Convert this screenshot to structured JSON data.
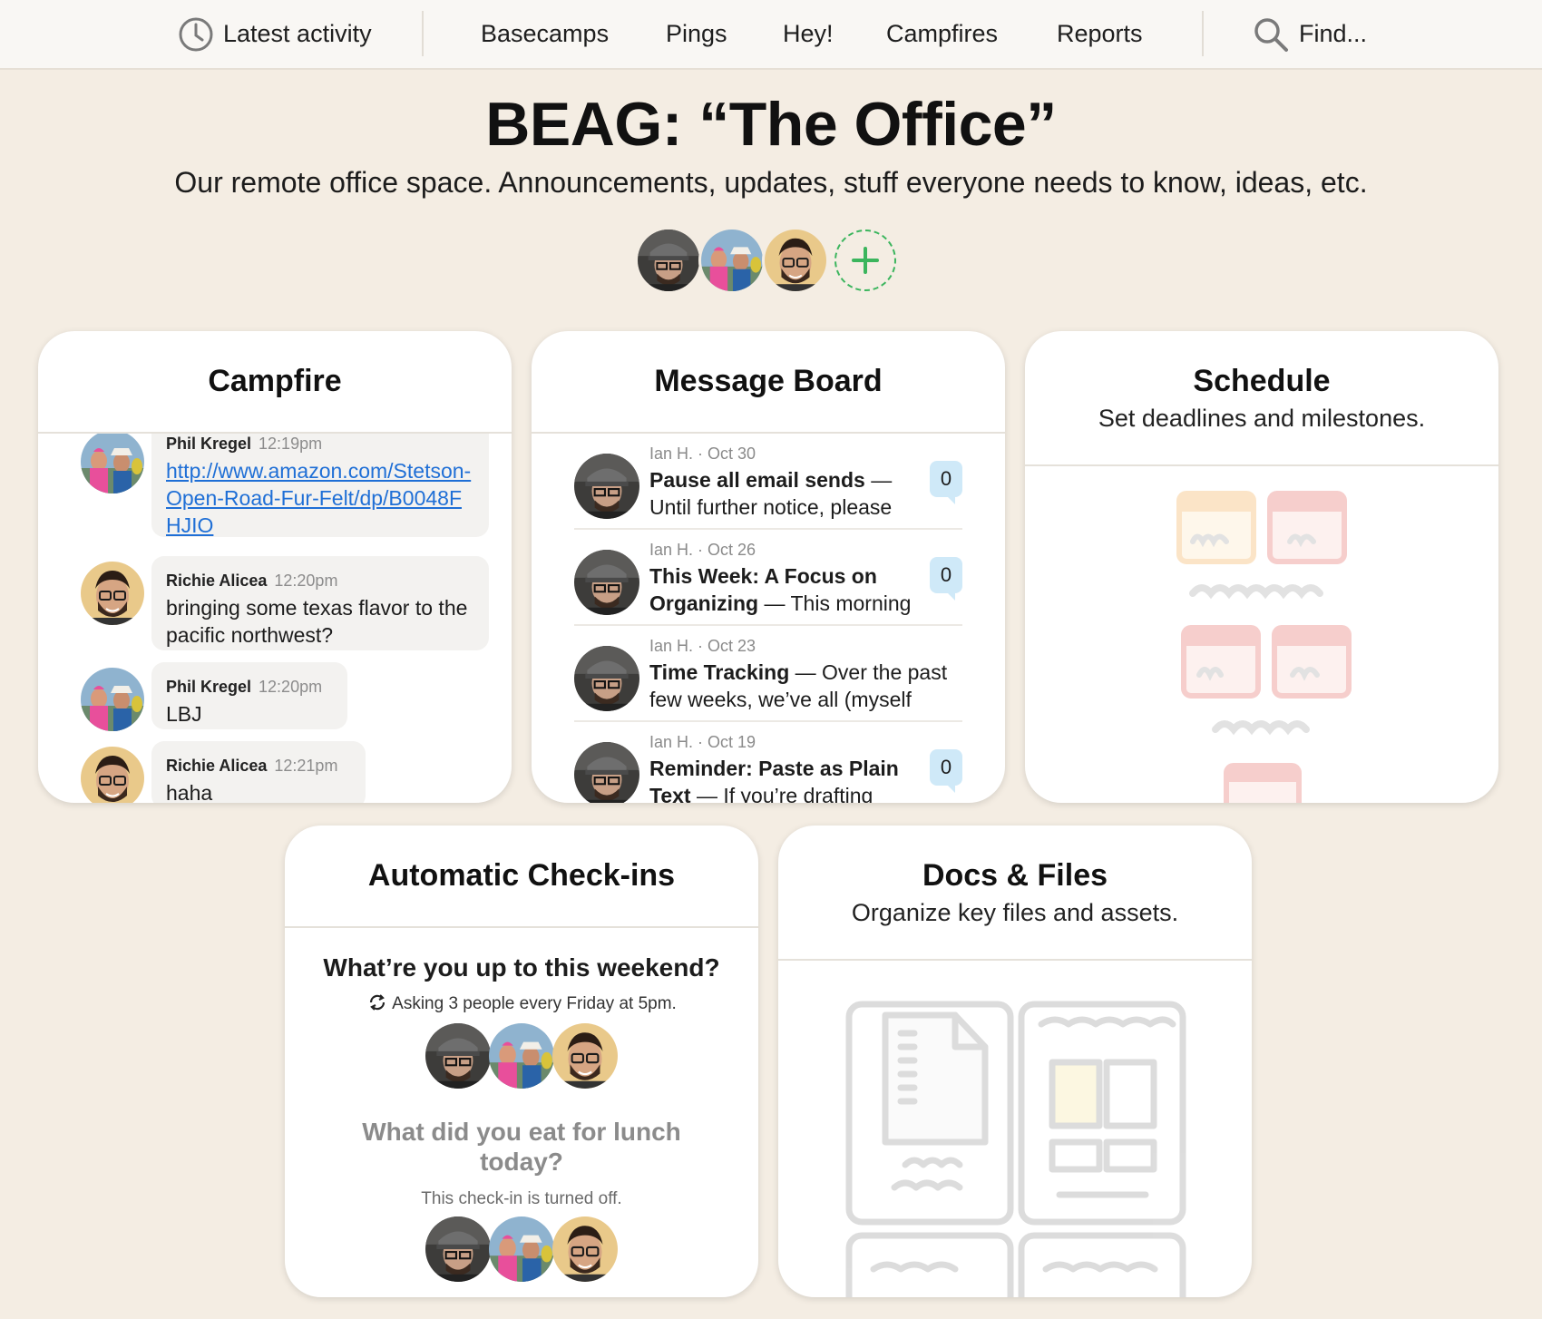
{
  "nav": {
    "latest_activity": "Latest activity",
    "basecamps": "Basecamps",
    "pings": "Pings",
    "hey": "Hey!",
    "campfires": "Campfires",
    "reports": "Reports",
    "find": "Find..."
  },
  "project": {
    "title": "BEAG: “The Office”",
    "description": "Our remote office space. Announcements, updates, stuff everyone needs to know, ideas, etc."
  },
  "colors": {
    "accent_green": "#3bb55d",
    "badge_blue": "#cfe9f8",
    "link_blue": "#1f6fd6",
    "background": "#f4ede3"
  },
  "campfire": {
    "title": "Campfire",
    "lines": [
      {
        "author": "Phil Kregel",
        "time": "12:19pm",
        "text": "http://www.amazon.com/Stetson-Open-Road-Fur-Felt/dp/B0048FHJIO"
      },
      {
        "author": "Richie Alicea",
        "time": "12:20pm",
        "text": "bringing some texas flavor to the pacific northwest?"
      },
      {
        "author": "Phil Kregel",
        "time": "12:20pm",
        "text": "LBJ"
      },
      {
        "author": "Richie Alicea",
        "time": "12:21pm",
        "text": "haha"
      }
    ]
  },
  "message_board": {
    "title": "Message Board",
    "messages": [
      {
        "meta": "Ian H. · Oct 30",
        "subject": "Pause all email sends",
        "excerpt": "— Until further notice, please",
        "comments": "0"
      },
      {
        "meta": "Ian H. · Oct 26",
        "subject": "This Week: A Focus on Organizing",
        "excerpt": "— This morning",
        "comments": "0"
      },
      {
        "meta": "Ian H. · Oct 23",
        "subject": "Time Tracking",
        "excerpt": "— Over the past few weeks, we’ve all (myself",
        "comments": ""
      },
      {
        "meta": "Ian H. · Oct 19",
        "subject": "Reminder: Paste as Plain Text",
        "excerpt": "— If you’re drafting",
        "comments": "0"
      }
    ]
  },
  "schedule": {
    "title": "Schedule",
    "subtitle": "Set deadlines and milestones."
  },
  "checkins": {
    "title": "Automatic Check-ins",
    "questions": [
      {
        "question": "What’re you up to this weekend?",
        "detail": "Asking 3 people every Friday at 5pm."
      },
      {
        "question": "What did you eat for lunch today?",
        "detail": "This check-in is turned off."
      }
    ]
  },
  "docs": {
    "title": "Docs & Files",
    "subtitle": "Organize key files and assets."
  },
  "avatars": [
    "avatar-ian",
    "avatar-phil",
    "avatar-richie"
  ]
}
